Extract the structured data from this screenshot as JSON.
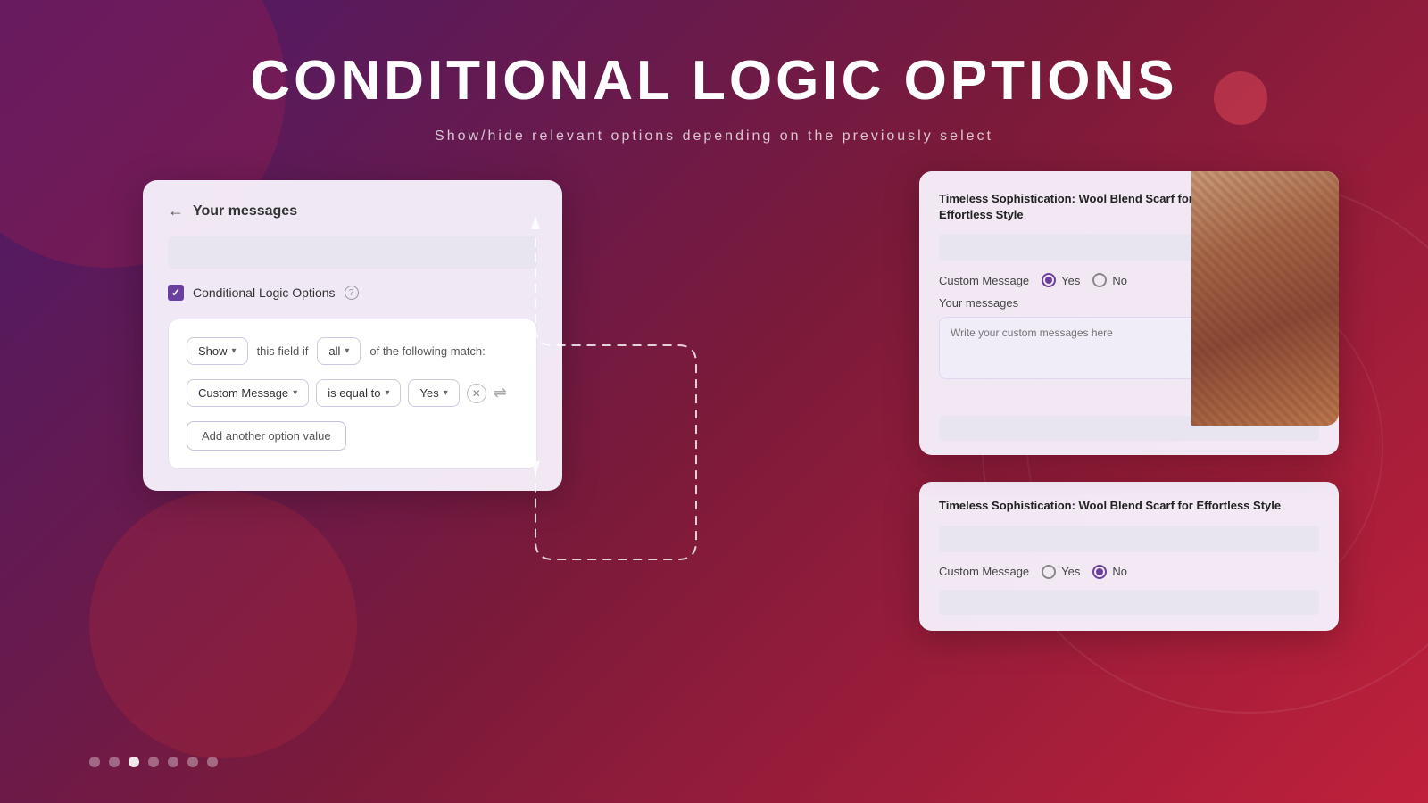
{
  "page": {
    "title": "CONDITIONAL LOGIC OPTIONS",
    "subtitle": "Show/hide relevant options depending on the previously select"
  },
  "left_panel": {
    "back_label": "←",
    "title": "Your messages",
    "checkbox_label": "Conditional Logic Options",
    "logic": {
      "show_label": "Show",
      "this_field_label": "this field if",
      "all_label": "all",
      "following_label": "of the following match:",
      "field_label": "Custom Message",
      "operator_label": "is equal to",
      "value_label": "Yes",
      "add_option_label": "Add another option value"
    }
  },
  "right_top_card": {
    "title": "Timeless Sophistication: Wool Blend Scarf for Effortless Style",
    "custom_message_label": "Custom Message",
    "yes_label": "Yes",
    "no_label": "No",
    "yes_selected": true,
    "no_selected": false,
    "your_messages_label": "Your messages",
    "textarea_placeholder": "Write your custom messages here",
    "submit_bar": ""
  },
  "right_bottom_card": {
    "title": "Timeless Sophistication: Wool Blend Scarf for Effortless Style",
    "custom_message_label": "Custom Message",
    "yes_label": "Yes",
    "no_label": "No",
    "yes_selected": false,
    "no_selected": true,
    "bottom_bar": ""
  },
  "pagination": {
    "dots": [
      {
        "active": false
      },
      {
        "active": false
      },
      {
        "active": true
      },
      {
        "active": false
      },
      {
        "active": false
      },
      {
        "active": false
      },
      {
        "active": false
      }
    ]
  }
}
